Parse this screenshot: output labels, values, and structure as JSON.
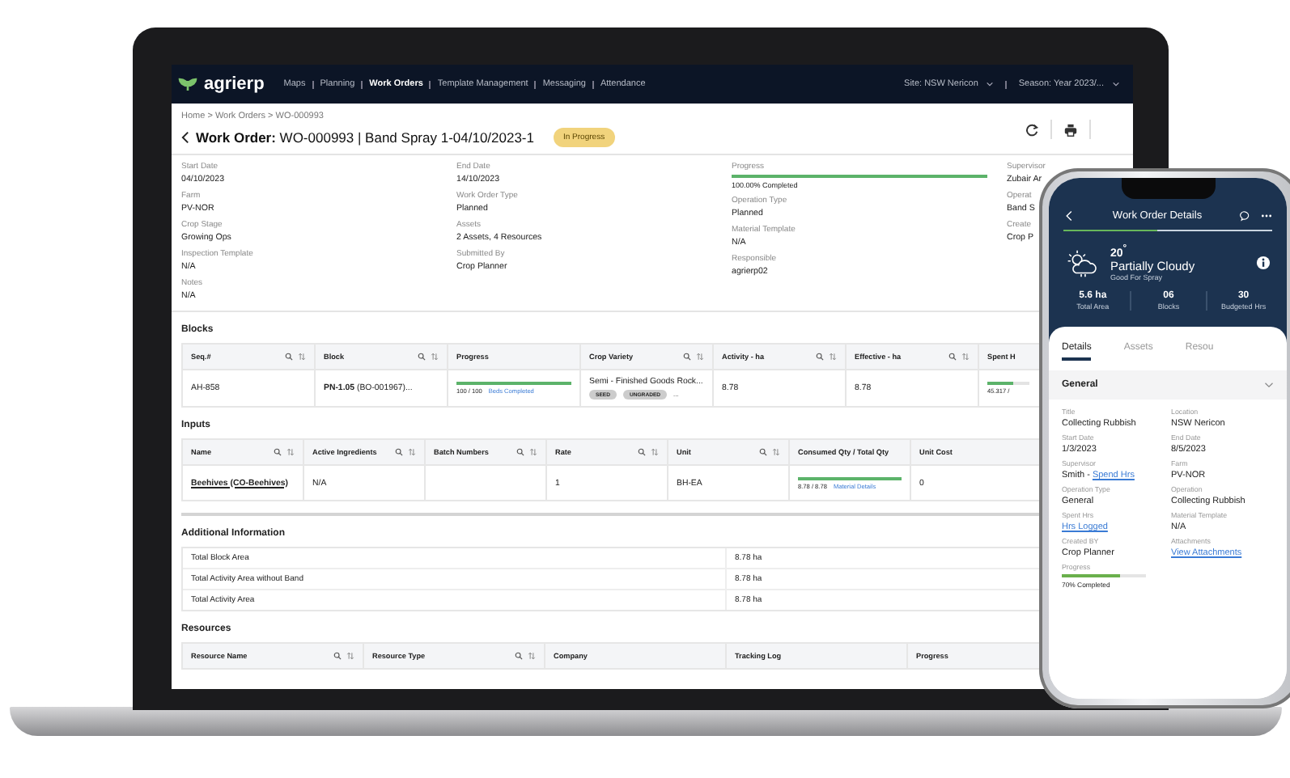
{
  "nav": {
    "logo": "agrierp",
    "items": [
      {
        "label": "Maps",
        "selected": false
      },
      {
        "label": "Planning",
        "selected": false
      },
      {
        "label": "Work Orders",
        "selected": true
      },
      {
        "label": "Template Management",
        "selected": false
      },
      {
        "label": "Messaging",
        "selected": false
      },
      {
        "label": "Attendance",
        "selected": false
      }
    ],
    "site": "Site: NSW Nericon",
    "season": "Season: Year 2023/..."
  },
  "breadcrumb": "Home > Work Orders > WO-000993",
  "title": "**Work Order:** WO-000993 | Band Spray 1-04/10/2023-1",
  "status": "In Progress",
  "fields": [
    [
      {
        "label": "Start Date",
        "value": "04/10/2023",
        "kind": "text"
      },
      {
        "label": "Farm",
        "value": "PV-NOR",
        "kind": "text"
      },
      {
        "label": "Crop Stage",
        "value": "Growing Ops",
        "kind": "text"
      },
      {
        "label": "Inspection Template",
        "value": "N/A",
        "kind": "text"
      },
      {
        "label": "Notes",
        "value": "N/A",
        "kind": "text"
      }
    ],
    [
      {
        "label": "End Date",
        "value": "14/10/2023",
        "kind": "text"
      },
      {
        "label": "Work Order Type",
        "value": "Planned",
        "kind": "text"
      },
      {
        "label": "Assets",
        "value": "2 Assets, 4 Resources",
        "kind": "text"
      },
      {
        "label": "Submitted By",
        "value": "Crop Planner",
        "kind": "text"
      }
    ],
    [
      {
        "label": "Progress",
        "value": "100.00% Completed",
        "kind": "progress",
        "level": 1
      },
      {
        "label": "Operation Type",
        "value": "Planned",
        "kind": "text"
      },
      {
        "label": "Material Template",
        "value": "N/A",
        "kind": "text"
      },
      {
        "label": "Responsible",
        "value": "agrierp02",
        "kind": "text"
      }
    ],
    [
      {
        "label": "Supervisor",
        "value": "Zubair Ar",
        "kind": "text"
      },
      {
        "label": "Operat",
        "value": "Band S",
        "kind": "text"
      },
      {
        "label": "Create",
        "value": "Crop P",
        "kind": "text"
      }
    ]
  ],
  "blocks": {
    "heading": "Blocks",
    "columns": [
      "Seq.#",
      "Block",
      "Progress",
      "Crop Variety",
      "Activity - ha",
      "Effective - ha",
      "Spent H"
    ],
    "row": [
      {
        "kind": "text",
        "text": "AH-858"
      },
      {
        "kind": "rich",
        "text": "**PN-1.05** (BO-001967)..."
      },
      {
        "kind": "progress",
        "level": 1,
        "text": "100 / 100",
        "link": "Beds Completed"
      },
      {
        "kind": "variety",
        "text": "Semi - Finished Goods Rock...",
        "tags": [
          "SEED",
          "UNGRADED",
          "..."
        ]
      },
      {
        "kind": "text",
        "text": "8.78"
      },
      {
        "kind": "text",
        "text": "8.78"
      },
      {
        "kind": "progress",
        "level": 0.6,
        "text": "45.317 /"
      }
    ]
  },
  "inputs": {
    "heading": "Inputs",
    "columns": [
      "Name",
      "Active Ingredients",
      "Batch Numbers",
      "Rate",
      "Unit",
      "Consumed Qty / Total Qty",
      "Unit Cost"
    ],
    "row": [
      {
        "kind": "link",
        "text": "Beehives (CO-Beehives)"
      },
      {
        "kind": "text",
        "text": "N/A"
      },
      {
        "kind": "empty"
      },
      {
        "kind": "text",
        "text": "1"
      },
      {
        "kind": "text",
        "text": "BH-EA"
      },
      {
        "kind": "progress",
        "level": 1,
        "text": "8.78 / 8.78",
        "link": "Material Details"
      },
      {
        "kind": "text",
        "text": "0"
      }
    ]
  },
  "additional": {
    "heading": "Additional Information",
    "rows": [
      {
        "label": "Total Block Area",
        "value": "8.78 ha"
      },
      {
        "label": "Total Activity Area without Band",
        "value": "8.78 ha"
      },
      {
        "label": "Total Activity Area",
        "value": "8.78 ha"
      }
    ]
  },
  "resources": {
    "heading": "Resources",
    "columns": [
      {
        "label": "Resource Name",
        "tools": true
      },
      {
        "label": "Resource Type",
        "tools": true
      },
      {
        "label": "Company",
        "tools": false
      },
      {
        "label": "Tracking Log",
        "tools": false
      },
      {
        "label": "Progress"
      }
    ]
  },
  "phone": {
    "title": "Work Order Details",
    "weather": {
      "temp": "20$^{°}$",
      "condition": "Partially Cloudy",
      "note": "Good For Spray"
    },
    "stats": [
      {
        "value": "5.6 ha",
        "label": "Total Area"
      },
      {
        "value": "06",
        "label": "Blocks"
      },
      {
        "value": "30",
        "label": "Budgeted Hrs"
      }
    ],
    "tabs": [
      {
        "label": "Details",
        "selected": true
      },
      {
        "label": "Assets",
        "selected": false
      },
      {
        "label": "Resou",
        "selected": false
      }
    ],
    "section": "General",
    "rows": [
      [
        {
          "label": "Title",
          "kind": "text",
          "value": "Collecting Rubbish"
        },
        {
          "label": "Location",
          "kind": "text",
          "value": "NSW Nericon"
        }
      ],
      [
        {
          "label": "Start Date",
          "kind": "text",
          "value": "1/3/2023"
        },
        {
          "label": "End Date",
          "kind": "text",
          "value": "8/5/2023"
        }
      ],
      [
        {
          "label": "Supervisor",
          "kind": "textlink",
          "value": "Smith -",
          "link": "Spend Hrs"
        },
        {
          "label": "Farm",
          "kind": "text",
          "value": "PV-NOR"
        }
      ],
      [
        {
          "label": "Operation Type",
          "kind": "text",
          "value": "General"
        },
        {
          "label": "Operation",
          "kind": "text",
          "value": "Collecting Rubbish"
        }
      ],
      [
        {
          "label": "Spent Hrs",
          "kind": "link",
          "link": "Hrs Logged"
        },
        {
          "label": "Material Template",
          "kind": "text",
          "value": "N/A"
        }
      ],
      [
        {
          "label": "Created BY",
          "kind": "text",
          "value": "Crop Planner"
        },
        {
          "label": "Attachments",
          "kind": "link",
          "link": "View Attachments"
        }
      ],
      [
        {
          "label": "Progress",
          "kind": "progress",
          "level": 0.7,
          "value": "70% Completed"
        }
      ]
    ]
  }
}
